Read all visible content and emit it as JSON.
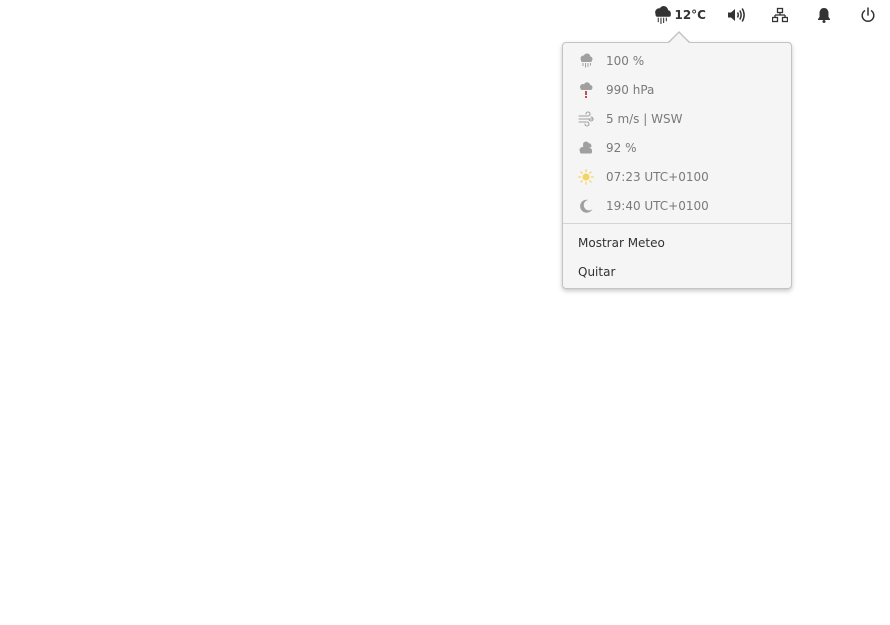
{
  "panel": {
    "weather": {
      "icon": "rain-cloud-icon",
      "temperature": "12°C"
    },
    "indicators": [
      {
        "icon": "volume-icon"
      },
      {
        "icon": "network-wired-icon"
      },
      {
        "icon": "notification-bell-icon"
      },
      {
        "icon": "power-icon"
      }
    ]
  },
  "weather_popover": {
    "details": [
      {
        "icon": "precipitation-icon",
        "value": "100 %"
      },
      {
        "icon": "pressure-icon",
        "value": "990 hPa"
      },
      {
        "icon": "wind-icon",
        "value": "5 m/s | WSW"
      },
      {
        "icon": "cloudiness-icon",
        "value": "92 %"
      },
      {
        "icon": "sunrise-icon",
        "value": "07:23 UTC+0100"
      },
      {
        "icon": "sunset-icon",
        "value": "19:40 UTC+0100"
      }
    ],
    "menu": {
      "show_label": "Mostrar Meteo",
      "quit_label": "Quitar"
    }
  },
  "colors": {
    "panel_icon": "#333333",
    "popover_bg": "#f5f5f5",
    "detail_text": "#7a7a7a",
    "menu_text": "#333333",
    "sun_accent": "#f4d35e",
    "pressure_accent": "#c0504d"
  }
}
